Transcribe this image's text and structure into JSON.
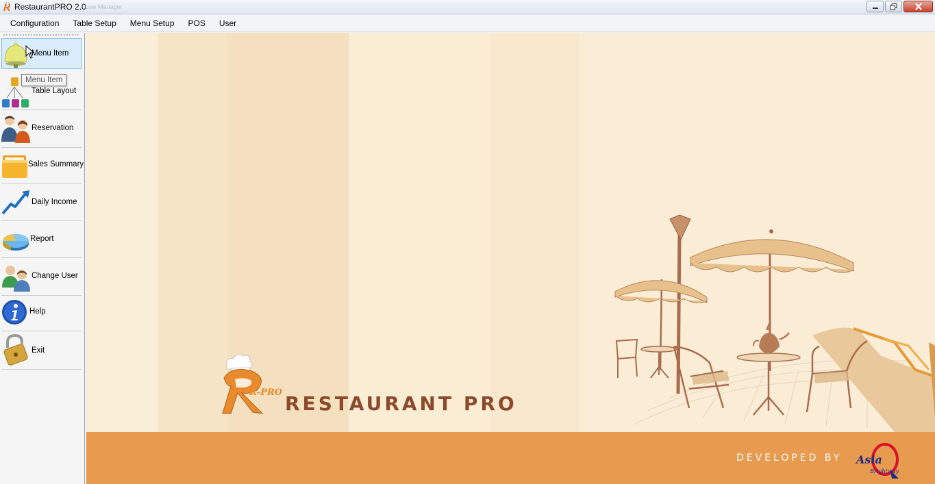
{
  "window": {
    "title": "RestaurantPRO 2.0",
    "ghost_text": "Low Manager"
  },
  "menubar": {
    "items": [
      "Configuration",
      "Table Setup",
      "Menu Setup",
      "POS",
      "User"
    ]
  },
  "sidebar": {
    "items": [
      {
        "label": "Menu Item",
        "icon": "food-cover-icon",
        "active": true
      },
      {
        "label": "Table Layout",
        "icon": "table-layout-icon"
      },
      {
        "label": "Reservation",
        "icon": "people-icon"
      },
      {
        "label": "Sales Summary",
        "icon": "folder-icon"
      },
      {
        "label": "Daily Income",
        "icon": "trend-arrow-icon"
      },
      {
        "label": "Report",
        "icon": "pie-chart-icon"
      },
      {
        "label": "Change User",
        "icon": "users-icon"
      },
      {
        "label": "Help",
        "icon": "info-icon"
      },
      {
        "label": "Exit",
        "icon": "padlock-icon"
      }
    ],
    "tooltip": "Menu Item"
  },
  "main": {
    "logo_mark": "R-PRO",
    "brand_name": "RESTAURANT PRO",
    "developed_by": "DEVELOPED BY",
    "developer_logo_text": "Asia Brightway"
  },
  "colors": {
    "accent_orange": "#e89a4f",
    "brand_brown": "#8b4a2a",
    "sidebar_active": "#d9ecfb"
  }
}
